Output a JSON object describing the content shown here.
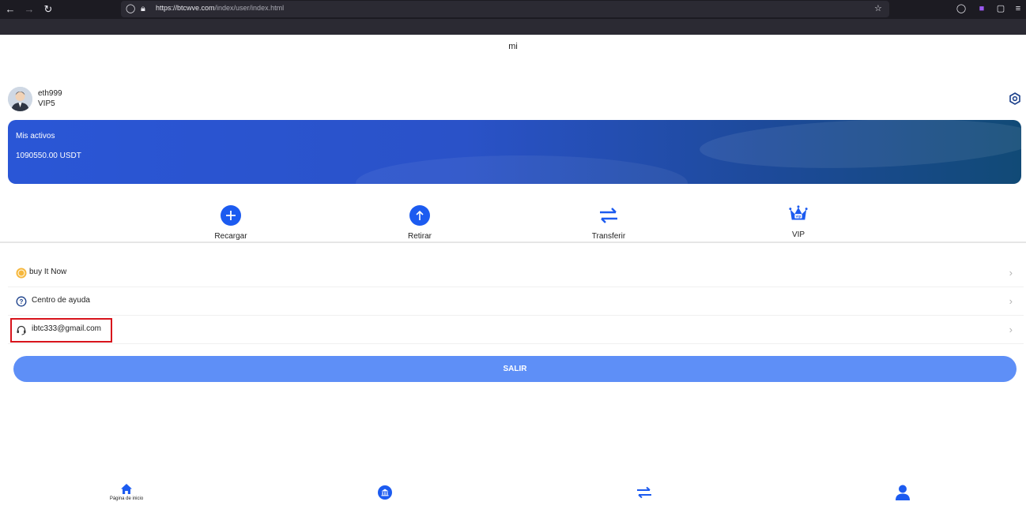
{
  "browser": {
    "url_host": "https://btcwve.com",
    "url_path": "/index/user/index.html"
  },
  "page": {
    "title": "mi"
  },
  "user": {
    "name": "eth999",
    "level": "VIP5"
  },
  "assets": {
    "label": "Mis activos",
    "value": "1090550.00 USDT"
  },
  "actions": [
    {
      "label": "Recargar",
      "icon": "plus-circle-icon"
    },
    {
      "label": "Retirar",
      "icon": "arrow-up-circle-icon"
    },
    {
      "label": "Transferir",
      "icon": "transfer-arrows-icon"
    },
    {
      "label": "VIP",
      "icon": "vip-crown-icon"
    }
  ],
  "menu": [
    {
      "label": "buy It Now",
      "icon": "coin-icon"
    },
    {
      "label": "Centro de ayuda",
      "icon": "help-circle-icon"
    },
    {
      "label": "ibtc333@gmail.com",
      "icon": "headset-icon"
    }
  ],
  "logout": {
    "label": "SALIR"
  },
  "tabbar": [
    {
      "label": "Página de inicio",
      "icon": "home-icon"
    },
    {
      "label": "",
      "icon": "bank-icon"
    },
    {
      "label": "",
      "icon": "exchange-icon"
    },
    {
      "label": "",
      "icon": "user-icon"
    }
  ],
  "colors": {
    "accent": "#1c5bf0",
    "button": "#5e8ff7",
    "highlight": "#d8141c"
  }
}
